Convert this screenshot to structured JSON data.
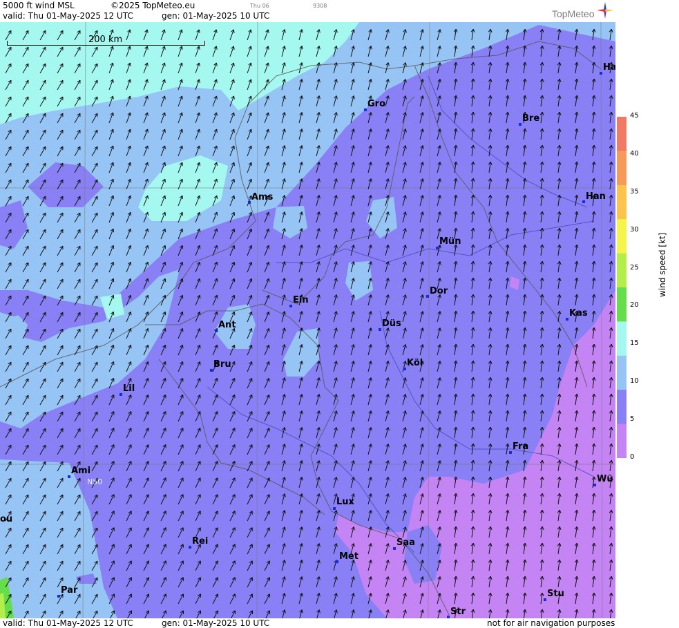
{
  "header": {
    "product": "5000 ft wind MSL",
    "copyright": "©2025 TopMeteo.eu",
    "small_left": "Thu 06",
    "small_right": "9308",
    "valid": "valid:  Thu  01-May-2025  12 UTC",
    "generated": "gen: 01-May-2025 10 UTC",
    "logo": "TopMeteo"
  },
  "footer": {
    "valid": "valid:  Thu  01-May-2025  12 UTC",
    "generated": "gen: 01-May-2025 10 UTC",
    "disclaimer": "not for air navigation purposes"
  },
  "map": {
    "scale_label": "200 km",
    "latitude_label": "N50",
    "cities": [
      {
        "name": "Gro"
      },
      {
        "name": "Bre"
      },
      {
        "name": "Ha"
      },
      {
        "name": "Ams"
      },
      {
        "name": "Han"
      },
      {
        "name": "Mün"
      },
      {
        "name": "Ein"
      },
      {
        "name": "Dor"
      },
      {
        "name": "Ant"
      },
      {
        "name": "Düs"
      },
      {
        "name": "Kas"
      },
      {
        "name": "Bru"
      },
      {
        "name": "Köl"
      },
      {
        "name": "Lil"
      },
      {
        "name": "Fra"
      },
      {
        "name": "Ami"
      },
      {
        "name": "Wü"
      },
      {
        "name": "Lux"
      },
      {
        "name": "Rei"
      },
      {
        "name": "Saa"
      },
      {
        "name": "Met"
      },
      {
        "name": "Par"
      },
      {
        "name": "Stu"
      },
      {
        "name": "Str"
      },
      {
        "name": "ou"
      }
    ]
  },
  "legend": {
    "title": "wind speed  [kt]",
    "ticks": [
      "45",
      "40",
      "35",
      "30",
      "25",
      "20",
      "15",
      "10",
      "5",
      "0"
    ],
    "colors": [
      "#f07a64",
      "#f59a58",
      "#fcc44a",
      "#f4f44a",
      "#b4ee4a",
      "#64de4a",
      "#a4f8f0",
      "#96c4f4",
      "#8880f4",
      "#c484f4"
    ]
  }
}
